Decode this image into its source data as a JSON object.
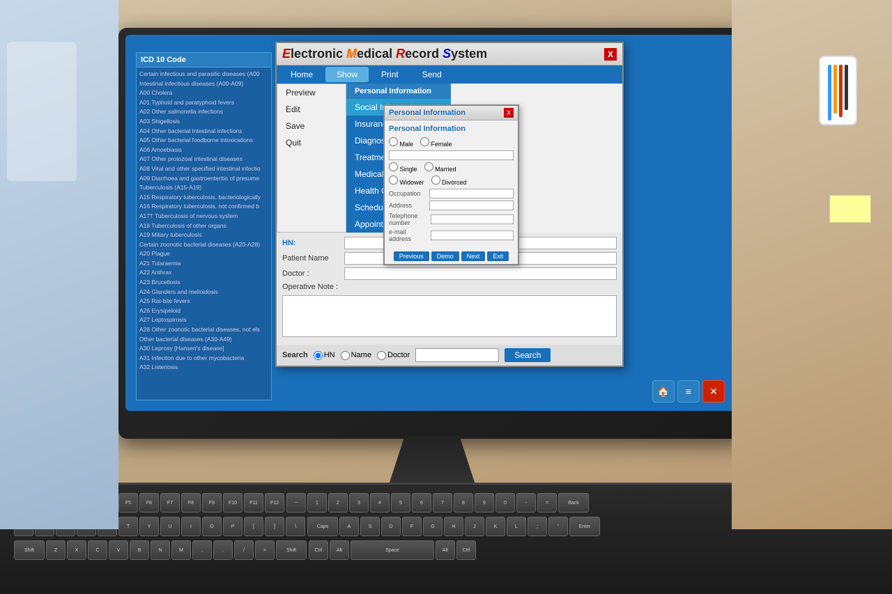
{
  "app": {
    "title_prefix": "Electronic ",
    "title_m": "M",
    "title_edical": "edical ",
    "title_r": "R",
    "title_ecord": "ecord ",
    "title_s": "S",
    "title_ystem": "ystem",
    "close_label": "X"
  },
  "menu": {
    "items": [
      {
        "label": "Home",
        "active": false
      },
      {
        "label": "Show",
        "active": true
      },
      {
        "label": "Print",
        "active": false
      },
      {
        "label": "Send",
        "active": false
      }
    ]
  },
  "show_dropdown": {
    "col1_items": [
      {
        "label": "Preview"
      },
      {
        "label": "Edit"
      },
      {
        "label": "Save"
      },
      {
        "label": "Quit"
      }
    ],
    "col2_header": "Personal Information",
    "col2_items": [
      {
        "label": "Social Information"
      },
      {
        "label": "Insurance"
      },
      {
        "label": "Diagnosis"
      },
      {
        "label": "Treatment"
      },
      {
        "label": "Medical History"
      },
      {
        "label": "Health Care Calendar"
      },
      {
        "label": "Schedule"
      },
      {
        "label": "Appointment"
      }
    ]
  },
  "patient_form": {
    "hn_label": "HN:",
    "hn_value": "",
    "patient_name_label": "Patient Name",
    "patient_name_value": "",
    "doctor_label": "Doctor :",
    "doctor_value": "",
    "op_note_label": "Operative Note :"
  },
  "search": {
    "label": "Search",
    "radio_hn": "HN",
    "radio_name": "Name",
    "radio_doctor": "Doctor",
    "input_placeholder": "",
    "button_label": "Search"
  },
  "personal_info": {
    "title": "Personal Information",
    "close_label": "X",
    "section_title": "Personal Information",
    "gender_options": [
      "Male",
      "Female"
    ],
    "status_options": [
      "Single",
      "Married",
      "Widower",
      "Divorced"
    ],
    "fields": [
      {
        "label": "Occupation"
      },
      {
        "label": "Address"
      },
      {
        "label": "Telephone number"
      },
      {
        "label": "e-mail address"
      }
    ],
    "buttons": [
      "Previous",
      "Demo",
      "Next",
      "Exit"
    ]
  },
  "icd": {
    "title": "ICD 10 Code",
    "items": [
      "Certain infectious and parasitic diseases (A00",
      "Intestinal infectious diseases (A00-A09)",
      "A00 Cholera",
      "A01 Typhoid and paratyphoid fevers",
      "A02 Other salmonella infections",
      "A03 Shigellosis",
      "A04 Other bacterial intestinal infections",
      "A05 Other bacterial foodborne intoxications",
      "A06 Amoebiasis",
      "A07 Other protozoal intestinal diseases",
      "A08 Viral and other specified intestinal infectio",
      "A09 Diarrhoea and gastroenteritis of presume",
      "Tuberculosis (A15-A19)",
      "A15 Respiratory tuberculosis, bacteriologically",
      "A16 Respiratory tuberculosis, not confirmed b",
      "A17† Tuberculosis of nervous system",
      "A18 Tuberculosis of other organs",
      "A19 Miliary tuberculosis",
      "Certain zoonotic bacterial diseases (A20-A28)",
      "A20 Plague",
      "A21 Tularaemia",
      "A22 Anthrax",
      "A23 Brucellosis",
      "A24 Glanders and melioidosis",
      "A25 Rat-bite fevers",
      "A26 Erysipeloid",
      "A27 Leptospirosis",
      "A28 Other zoonotic bacterial diseases, not els",
      "Other bacterial diseases (A30-A49)",
      "A30 Leprosy [Hansen's disease]",
      "A31 Infection due to other mycobacteria",
      "A32 Listeriosis"
    ]
  },
  "taskbar": {
    "icons": [
      "🏠",
      "≡",
      "✕"
    ]
  }
}
